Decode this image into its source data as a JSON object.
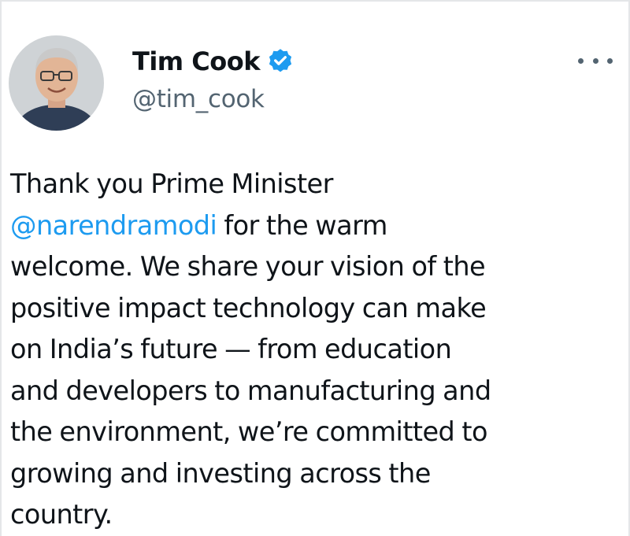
{
  "author": {
    "display_name": "Tim Cook",
    "handle": "@tim_cook",
    "verified": true,
    "verified_color": "#1d9bf0"
  },
  "more_menu": {
    "icon": "more-horizontal-icon"
  },
  "tweet": {
    "lines": [
      "Thank you Prime Minister",
      " for the warm",
      "welcome. We share your vision of the",
      "positive impact technology can make",
      "on India’s future — from education",
      "and developers to manufacturing and",
      "the environment, we’re committed to",
      "growing and investing across the",
      "country."
    ],
    "mention": "@narendramodi"
  },
  "colors": {
    "text": "#0f1419",
    "secondary_text": "#536471",
    "link": "#1d9bf0",
    "border": "#e4e6e8"
  }
}
